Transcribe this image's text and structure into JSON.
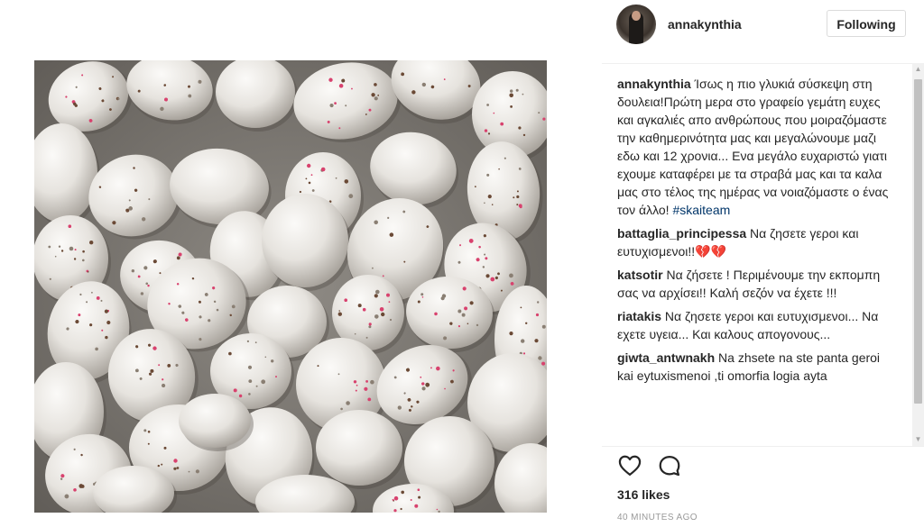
{
  "post": {
    "photo_subject": "speckled-candy-eggs"
  },
  "header": {
    "username": "annakynthia",
    "follow_label": "Following"
  },
  "comments": [
    {
      "user": "annakynthia",
      "text": " Ίσως η πιο γλυκιά σύσκεψη στη δουλεια!Πρώτη μερα στο γραφείο γεμάτη ευχες και αγκαλιές απο ανθρώπους που μοιραζόμαστε την καθημερινότητα μας και μεγαλώνουμε μαζι εδω και 12 χρονια... Ενα μεγάλο ευχαριστώ γιατι εχουμε καταφέρει με τα στραβά μας και τα καλα μας στο τέλος της ημέρας να νοιαζόμαστε ο ένας τον άλλο! ",
      "hashtag": "#skaiteam"
    },
    {
      "user": "battaglia_principessa",
      "text": " Να ζησετε γεροι και ευτυχισμενοι!!💔💔",
      "hashtag": ""
    },
    {
      "user": "katsotir",
      "text": " Να ζήσετε ! Περιμένουμε την εκπομπη σας να αρχίσει!! Καλή σεζόν να έχετε !!!",
      "hashtag": ""
    },
    {
      "user": "riatakis",
      "text": " Να ζησετε γεροι και ευτυχισμενοι... Να εχετε υγεια... Και καλους απογονους...",
      "hashtag": ""
    },
    {
      "user": "giwta_antwnakh",
      "text": " Na zhsete na ste panta geroi kai eytuxismenoi ,ti omorfia logia ayta",
      "hashtag": ""
    }
  ],
  "actions": {
    "like_icon": "heart-icon",
    "comment_icon": "speech-bubble-icon"
  },
  "likes": "316 likes",
  "timestamp": "40 MINUTES AGO",
  "colors": {
    "text": "#262626",
    "hashtag": "#003569",
    "muted": "#999999",
    "border": "#dbdbdb"
  }
}
